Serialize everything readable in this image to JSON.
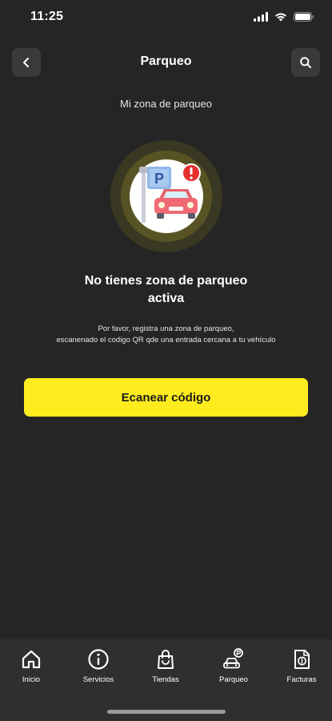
{
  "status_bar": {
    "time": "11:25"
  },
  "header": {
    "title": "Parqueo"
  },
  "section_label": "Mi zona de parqueo",
  "empty_state": {
    "title_line1": "No tienes zona de parqueo",
    "title_line2": "activa",
    "description_line1": "Por favor, registra una zona de parqueo,",
    "description_line2": "escanenado el codigo QR qde una entrada cercana a tu vehículo",
    "sign_letter": "P"
  },
  "scan_button_label": "Ecanear código",
  "tabs": [
    {
      "label": "Inicio",
      "icon": "home-icon"
    },
    {
      "label": "Servicios",
      "icon": "info-icon"
    },
    {
      "label": "Tiendas",
      "icon": "shopping-bag-icon"
    },
    {
      "label": "Parqueo",
      "icon": "parking-car-icon"
    },
    {
      "label": "Facturas",
      "icon": "invoice-icon"
    }
  ],
  "colors": {
    "background": "#252525",
    "accent": "#ffec1f",
    "tab_bar": "#2f2f2f",
    "button_bg": "#3a3a3a"
  }
}
